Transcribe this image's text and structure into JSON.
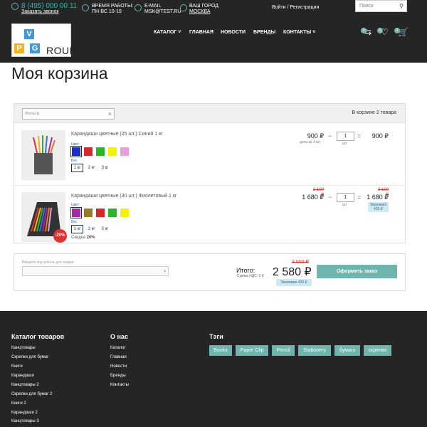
{
  "header": {
    "phone": "8 (495) 000 00 11",
    "callback": "Заказать звонок",
    "hours_label": "ВРЕМЯ РАБОТЫ:",
    "hours_value": "ПН-ВС 10-19",
    "email_label": "E-MAIL",
    "email_value": "MSK@TEST.RU",
    "city_label": "ВАШ ГОРОД",
    "city_value": "МОСКВА",
    "auth": "Войти / Регистрация",
    "search_placeholder": "Поиск",
    "logo_letters": [
      "V",
      "P",
      "G"
    ],
    "logo_rest": "ROUP",
    "nav": [
      "КАТАЛОГ",
      "ГЛАВНАЯ",
      "НОВОСТИ",
      "БРЕНДЫ",
      "КОНТАКТЫ"
    ],
    "badges": [
      "0",
      "0",
      "2"
    ]
  },
  "page_title": "Моя корзина",
  "cart": {
    "filter_placeholder": "Фильтр",
    "count_text": "В корзине 2 товара",
    "items": [
      {
        "name": "Карандаши цветные (25 шт.) Синий 1 кг",
        "color_label": "Цвет",
        "colors": [
          "#1a2fc9",
          "#d42a2a",
          "#2bb52b",
          "#f5f20a",
          "#e79fe0"
        ],
        "weight_label": "Вес",
        "weights": [
          "1 кг",
          "2 кг",
          "3 кг"
        ],
        "price": "900 ₽",
        "price_hint": "цена за 1 шт",
        "qty": "1",
        "qty_unit": "шт",
        "total": "900 ₽"
      },
      {
        "name": "Карандаши цветные (30 шт.) Фиолетовый 1 кг",
        "color_label": "Цвет",
        "colors": [
          "#a42aa8",
          "#9b7a25",
          "#d42a2a",
          "#2bb52b",
          "#f5f20a"
        ],
        "weight_label": "Вес",
        "weights": [
          "1 кг",
          "2 кг",
          "3 кг"
        ],
        "discount_badge": "-20%",
        "discount_label": "Скидка",
        "discount_value": "20%",
        "old_price": "2 100 ₽",
        "price": "1 680 ₽",
        "qty": "1",
        "qty_unit": "шт",
        "old_total": "2 100 ₽",
        "total": "1 680 ₽",
        "economy": "Экономия 420 ₽"
      }
    ],
    "minus": "−",
    "plus": "+",
    "eq": "=",
    "clear": "×"
  },
  "summary": {
    "coupon_label": "Введите код купона для скидки:",
    "total_label": "Итого:",
    "vat": "Сумма НДС: 0 ₽",
    "old_sum": "3 000 ₽",
    "sum": "2 580 ₽",
    "economy": "Экономия 420 ₽",
    "order_button": "Оформить заказ"
  },
  "footer": {
    "catalog_title": "Каталог товаров",
    "catalog_links": [
      "Канцтовары",
      "Скрепки для бумаг",
      "Книги",
      "Карандаши",
      "Канцтовары 2",
      "Скрепки для бумаг 2",
      "Книги 2",
      "Карандаши 2",
      "Канцтовары 3"
    ],
    "about_title": "О нас",
    "about_links": [
      "Каталог",
      "Главная",
      "Новости",
      "Бренды",
      "Контакты"
    ],
    "tags_title": "Тэги",
    "tags": [
      "Books",
      "Paper Clip",
      "Pencil",
      "Stationery",
      "бумага",
      "скрепки"
    ]
  },
  "icons": [
    "phone-icon",
    "clock-icon",
    "mail-icon",
    "location-icon",
    "search-icon",
    "compare-icon",
    "heart-icon",
    "cart-icon",
    "pencils-product-image",
    "cart-arrow-icon"
  ]
}
